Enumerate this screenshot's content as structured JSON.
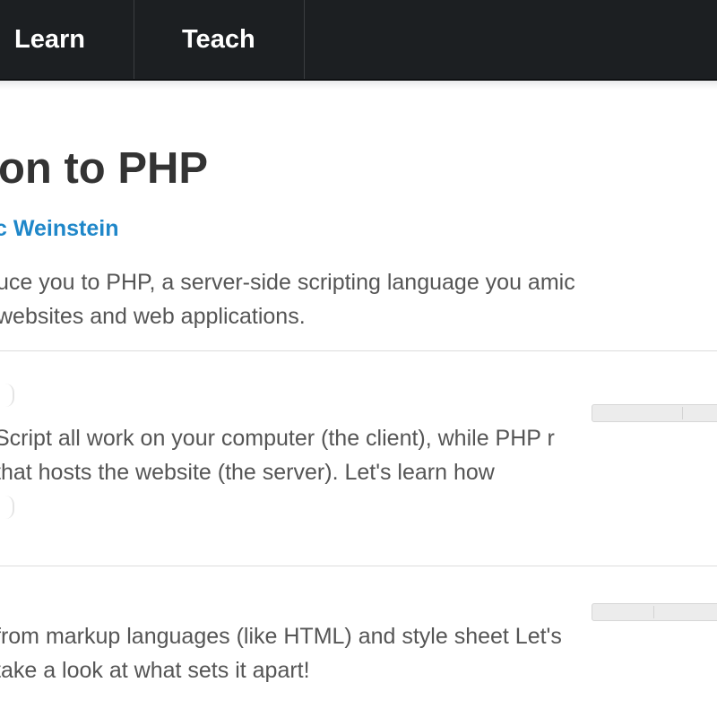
{
  "nav": {
    "items": [
      {
        "label": "Learn"
      },
      {
        "label": "Teach"
      }
    ]
  },
  "course": {
    "title": "on to PHP",
    "author": "c Weinstein",
    "description": "uce you to PHP, a server-side scripting language you amic websites and web applications."
  },
  "lessons": [
    {
      "description": "Script all work on your computer (the client), while PHP r that hosts the website (the server). Let's learn how",
      "progress": 0
    },
    {
      "description": "from markup languages (like HTML) and style sheet Let's take a look at what sets it apart!",
      "progress": 0
    }
  ],
  "colors": {
    "nav_bg": "#1c1f22",
    "author_link": "#1f87c9",
    "title": "#333333",
    "body_text": "#555555"
  }
}
